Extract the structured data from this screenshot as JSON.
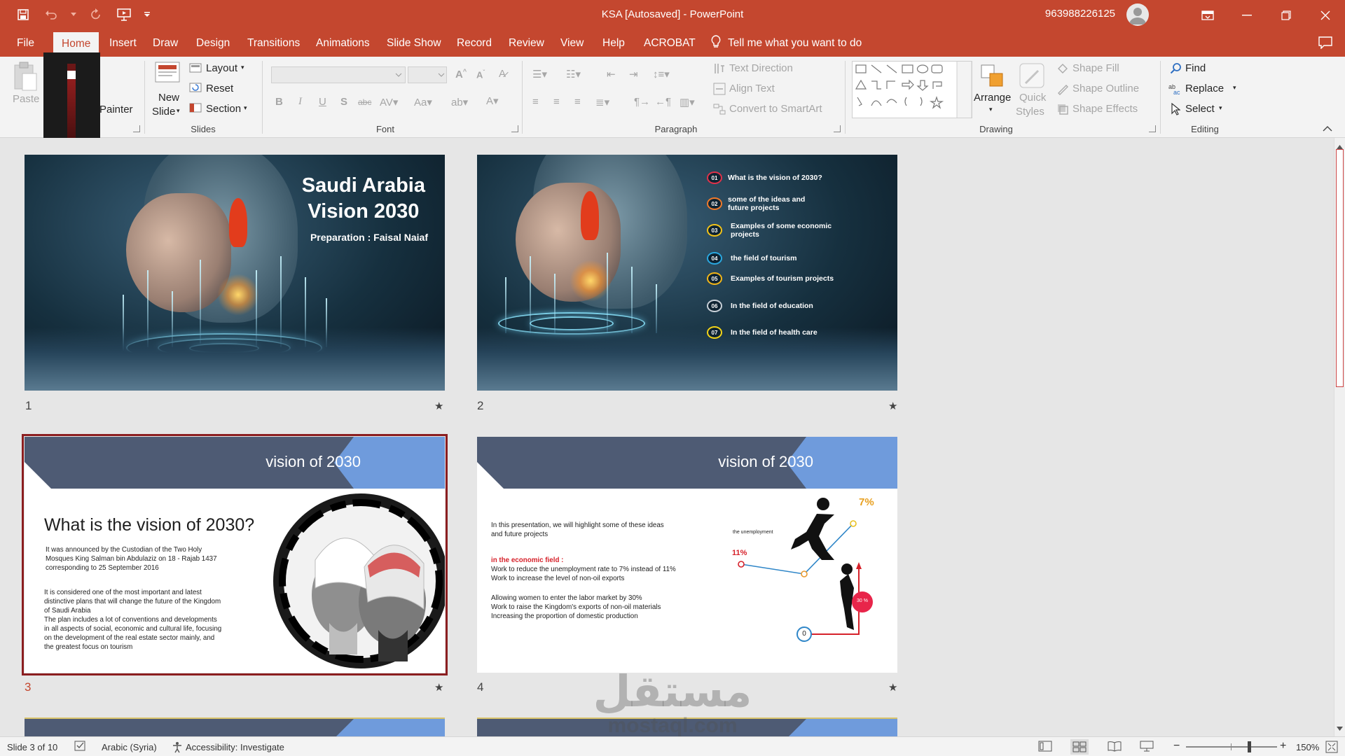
{
  "titlebar": {
    "title": "KSA [Autosaved]  -  PowerPoint",
    "user": "963988226125"
  },
  "tabs": [
    "File",
    "Home",
    "Insert",
    "Draw",
    "Design",
    "Transitions",
    "Animations",
    "Slide Show",
    "Record",
    "Review",
    "View",
    "Help",
    "ACROBAT"
  ],
  "tell_me": "Tell me what you want to do",
  "ribbon": {
    "clipboard": {
      "paste": "Paste",
      "painter": "Painter"
    },
    "slides": {
      "new_slide_1": "New",
      "new_slide_2": "Slide",
      "layout": "Layout",
      "reset": "Reset",
      "section": "Section",
      "label": "Slides"
    },
    "font": {
      "label": "Font"
    },
    "paragraph": {
      "text_direction": "Text Direction",
      "align_text": "Align Text",
      "smartart": "Convert to SmartArt",
      "label": "Paragraph"
    },
    "drawing": {
      "arrange": "Arrange",
      "quick_1": "Quick",
      "quick_2": "Styles",
      "shape_fill": "Shape Fill",
      "shape_outline": "Shape Outline",
      "shape_effects": "Shape Effects",
      "label": "Drawing"
    },
    "editing": {
      "find": "Find",
      "replace": "Replace",
      "select": "Select",
      "label": "Editing"
    }
  },
  "slides": {
    "s1": {
      "num": "1",
      "title_1": "Saudi Arabia",
      "title_2": "Vision  2030",
      "subtitle": "Preparation : Faisal Naiaf"
    },
    "s2": {
      "num": "2",
      "items": [
        {
          "n": "01",
          "text": "What is the vision of 2030?",
          "color": "#e0324a"
        },
        {
          "n": "02",
          "text": "some of the ideas and future projects",
          "color": "#f07a2a"
        },
        {
          "n": "03",
          "text": "Examples of some economic projects",
          "color": "#f3c318"
        },
        {
          "n": "04",
          "text": "the field of tourism",
          "color": "#2aa8e0"
        },
        {
          "n": "05",
          "text": "Examples of tourism projects",
          "color": "#f3b618"
        },
        {
          "n": "06",
          "text": "In the field of education",
          "color": "#c8d0d8"
        },
        {
          "n": "07",
          "text": "In the field of health care",
          "color": "#f3d418"
        }
      ]
    },
    "s3": {
      "num": "3",
      "banner": "vision of 2030",
      "heading": "What is the vision of 2030?",
      "p1_1": "It was announced by the Custodian of the Two Holy",
      "p1_2": "Mosques King Salman bin Abdulaziz on 18 - Rajab 1437",
      "p1_3": "corresponding to 25 September 2016",
      "p2_1": "It is considered one of the most important and latest",
      "p2_2": "distinctive plans that will change the future of the Kingdom",
      "p2_3": "of Saudi Arabia",
      "p2_4": "The plan includes a lot of conventions and developments",
      "p2_5": "in all aspects of social, economic and cultural life, focusing",
      "p2_6": "on the development of the real estate sector mainly, and",
      "p2_7": "the greatest focus on tourism"
    },
    "s4": {
      "num": "4",
      "banner": "vision of 2030",
      "p1_1": "In this presentation, we will highlight some of these ideas",
      "p1_2": "and future projects",
      "red": "in the economic field :",
      "p2_1": " Work to reduce the unemployment rate to 7% instead of 11%",
      "p2_2": "Work to increase the level of non-oil exports",
      "p3_1": "Allowing women to enter the labor market by 30%",
      "p3_2": "Work to raise the Kingdom's exports of non-oil materials",
      "p3_3": "Increasing the proportion of domestic production",
      "chart_label": "the unemployment",
      "pct_7": "7%",
      "pct_11": "11%",
      "pct_30": "30 %",
      "zero": "0"
    }
  },
  "watermark": {
    "arabic": "مستقل",
    "latin": "mostaql.com"
  },
  "status": {
    "slide": "Slide 3 of 10",
    "language": "Arabic (Syria)",
    "accessibility": "Accessibility: Investigate",
    "zoom": "150%"
  }
}
